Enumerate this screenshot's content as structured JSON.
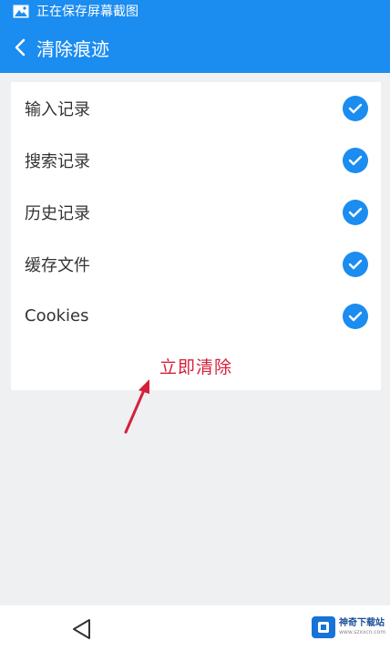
{
  "status_bar": {
    "text": "正在保存屏幕截图",
    "icon": "image-icon"
  },
  "header": {
    "title": "清除痕迹",
    "back_icon": "chevron-left-icon"
  },
  "options": [
    {
      "label": "输入记录",
      "checked": true
    },
    {
      "label": "搜索记录",
      "checked": true
    },
    {
      "label": "历史记录",
      "checked": true
    },
    {
      "label": "缓存文件",
      "checked": true
    },
    {
      "label": "Cookies",
      "checked": true
    }
  ],
  "clear_button": {
    "label": "立即清除"
  },
  "nav_bar": {
    "back_icon": "triangle-back-icon"
  },
  "watermark": {
    "name": "神奇下载站",
    "url": "www.szxxcn.com"
  },
  "colors": {
    "accent": "#1b8cf0",
    "danger": "#d6203b",
    "background": "#eef0f1"
  }
}
